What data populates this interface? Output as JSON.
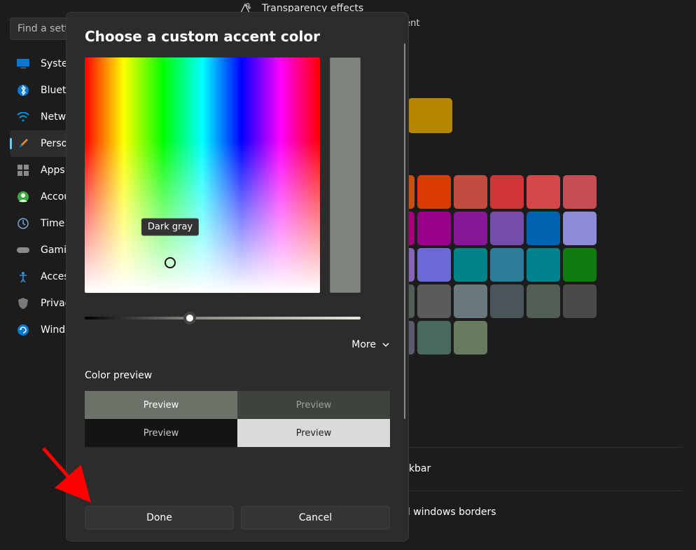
{
  "sidebar": {
    "search_placeholder": "Find a setti",
    "items": [
      {
        "label": "Syste"
      },
      {
        "label": "Blueto"
      },
      {
        "label": "Netwo"
      },
      {
        "label": "Perso"
      },
      {
        "label": "Apps"
      },
      {
        "label": "Accou"
      },
      {
        "label": "Time "
      },
      {
        "label": "Gamin"
      },
      {
        "label": "Acces"
      },
      {
        "label": "Privac"
      },
      {
        "label": "Windo"
      }
    ]
  },
  "main": {
    "transparency_label": "Transparency effects",
    "cent_label": "cent",
    "taskbar_row": "askbar",
    "borders_row": "nd windows borders",
    "accent_colors": [
      "#0078d4",
      "#b58600"
    ],
    "grid_colors": [
      "#ca5010",
      "#da3b01",
      "#c14c3f",
      "#d13438",
      "#d4474a",
      "#c84c54",
      "#a8007a",
      "#9a0089",
      "#881798",
      "#744da9",
      "#0063b1",
      "#8e8cd8",
      "#8764b8",
      "#6b69d6",
      "#038387",
      "#2d7d9a",
      "#00838c",
      "#107c10",
      "#525e54",
      "#5b5b5b",
      "#69797e",
      "#4a5459",
      "#525e54",
      "#4c4a48",
      "#585c6d",
      "#486860",
      "#677b61"
    ]
  },
  "modal": {
    "title": "Choose a custom accent color",
    "tooltip": "Dark gray",
    "preview_color": "#7f857d",
    "more_label": "More",
    "section_label": "Color preview",
    "preview_text": "Preview",
    "done_label": "Done",
    "cancel_label": "Cancel"
  }
}
